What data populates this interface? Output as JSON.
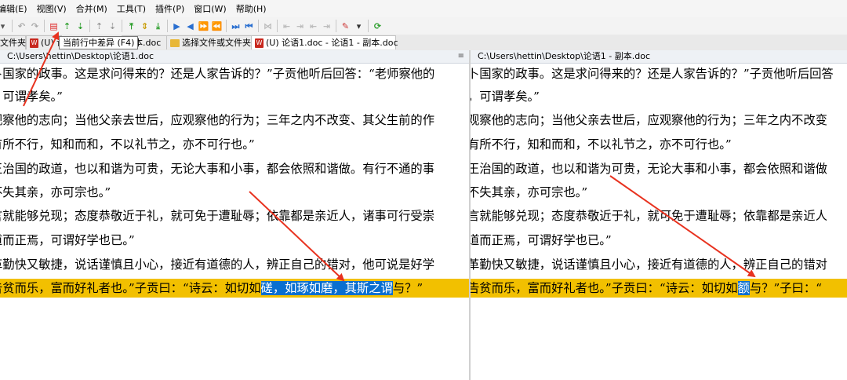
{
  "menu": [
    "编辑(E)",
    "视图(V)",
    "合并(M)",
    "工具(T)",
    "插件(P)",
    "窗口(W)",
    "帮助(H)"
  ],
  "tabs": {
    "t1": "文件夹",
    "t2": "(U) 论",
    "t3": "副本.doc",
    "t4": "选择文件或文件夹",
    "t5": "(U) 论语1.doc - 论语1 - 副本.doc"
  },
  "tooltip": "当前行中差异 (F4)",
  "left": {
    "path": "C:\\Users\\hettin\\Desktop\\论语1.doc",
    "lines": [
      "卜国家的政事。这是求问得来的？还是人家告诉的？”子贡他听后回答：“老师察他的",
      "，可谓孝矣。”",
      "观察他的志向；当他父亲去世后，应观察他的行为；三年之内不改变、其父生前的作",
      "有所不行，知和而和，不以礼节之，亦不可行也。”",
      "王治国的政道，也以和谐为可贵，无论大事和小事，都会依照和谐做。有行不通的事",
      "不失其亲，亦可宗也。”",
      "言就能够兑现；态度恭敬近于礼，就可免于遭耻辱；依靠都是亲近人，诸事可行受崇",
      "道而正焉，可谓好学也已。”",
      "革勤快又敏捷，说话谨慎且小心，接近有道德的人，辨正自己的错对，他可说是好学"
    ],
    "diff_pre": "告贫而乐，富而好礼者也。”子贡曰：“诗云：如切如",
    "diff_hl": "磋，如琢如磨，其斯之谓",
    "diff_post": "与？”"
  },
  "right": {
    "path": "C:\\Users\\hettin\\Desktop\\论语1 - 副本.doc",
    "lines": [
      "卜国家的政事。这是求问得来的？还是人家告诉的？”子贡他听后回答",
      "，可谓孝矣。”",
      "观察他的志向；当他父亲去世后，应观察他的行为；三年之内不改变",
      "有所不行，知和而和，不以礼节之，亦不可行也。”",
      "王治国的政道，也以和谐为可贵，无论大事和小事，都会依照和谐做",
      "不失其亲，亦可宗也。”",
      "言就能够兑现；态度恭敬近于礼，就可免于遭耻辱；依靠都是亲近人",
      "道而正焉，可谓好学也已。”",
      "革勤快又敏捷，说话谨慎且小心，接近有道德的人，辨正自己的错对"
    ],
    "diff_pre": "告贫而乐，富而好礼者也。”子贡曰：“诗云：如切如",
    "diff_hl": "额",
    "diff_post": "与？”子曰：“"
  },
  "colors": {
    "diff_line": "#f2c000",
    "diff_highlight": "#0a6fd0",
    "arrow": "#e8321f"
  }
}
